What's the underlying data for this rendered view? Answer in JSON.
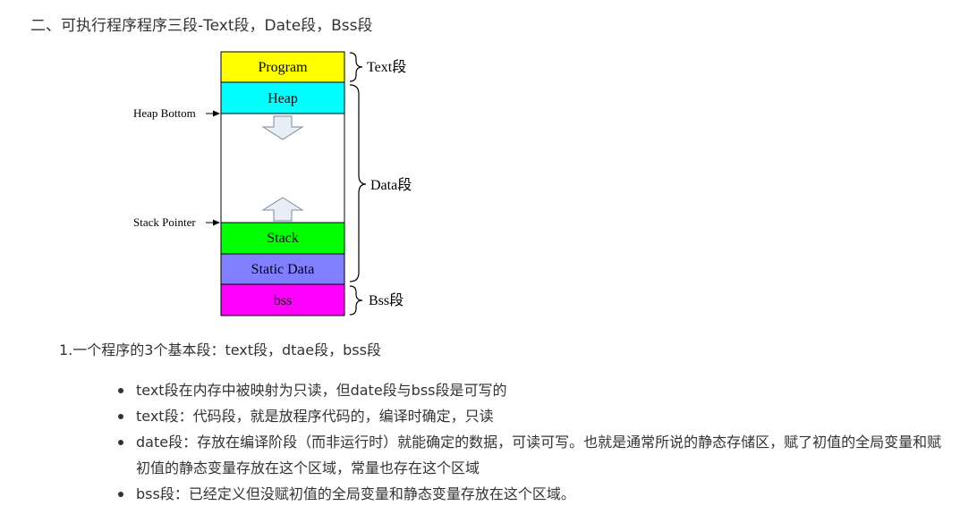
{
  "heading": "二、可执行程序程序三段-Text段，Date段，Bss段",
  "diagram": {
    "segments": [
      {
        "name": "program",
        "label": "Program",
        "color": "#ffff00"
      },
      {
        "name": "heap",
        "label": "Heap",
        "color": "#00ffff"
      },
      {
        "name": "free",
        "label": "",
        "color": "#ffffff"
      },
      {
        "name": "stack",
        "label": "Stack",
        "color": "#00ff00"
      },
      {
        "name": "static-data",
        "label": "Static Data",
        "color": "#8080ff"
      },
      {
        "name": "bss",
        "label": "bss",
        "color": "#ff00ff"
      }
    ],
    "pointers": {
      "heap_bottom": "Heap Bottom",
      "stack_pointer": "Stack Pointer"
    },
    "braces": {
      "text": "Text段",
      "data": "Data段",
      "bss": "Bss段"
    },
    "arrow_fill": "#e8eef6"
  },
  "subheading": "1.一个程序的3个基本段：text段，dtae段，bss段",
  "bullets": [
    "text段在内存中被映射为只读，但date段与bss段是可写的",
    "text段：代码段，就是放程序代码的，编译时确定，只读",
    "date段：存放在编译阶段（而非运行时）就能确定的数据，可读可写。也就是通常所说的静态存储区，赋了初值的全局变量和赋初值的静态变量存放在这个区域，常量也存在这个区域",
    "bss段：已经定义但没赋初值的全局变量和静态变量存放在这个区域。"
  ]
}
